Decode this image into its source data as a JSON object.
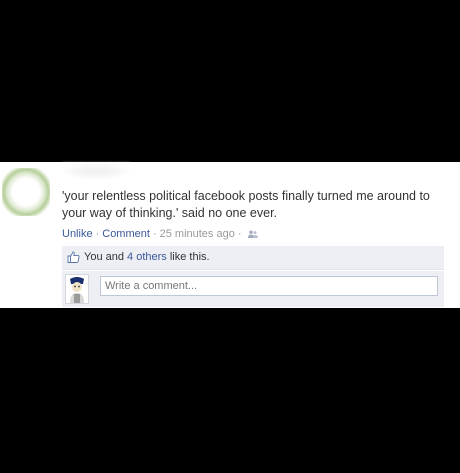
{
  "post": {
    "text": "'your relentless political facebook posts finally turned me around to your way of thinking.' said no one ever.",
    "actions": {
      "unlike": "Unlike",
      "comment": "Comment",
      "time": "25 minutes ago",
      "sep1": "·",
      "sep2": "·",
      "sep3": "·"
    },
    "likes": {
      "prefix": "You and ",
      "others_link": "4 others",
      "suffix": " like this."
    },
    "comment_box": {
      "placeholder": "Write a comment..."
    }
  },
  "colors": {
    "link": "#3b5998",
    "ufi_background": "#edeff4",
    "page_background": "#000000"
  },
  "icons": {
    "audience": "friends-icon",
    "like": "thumbs-up-icon"
  }
}
